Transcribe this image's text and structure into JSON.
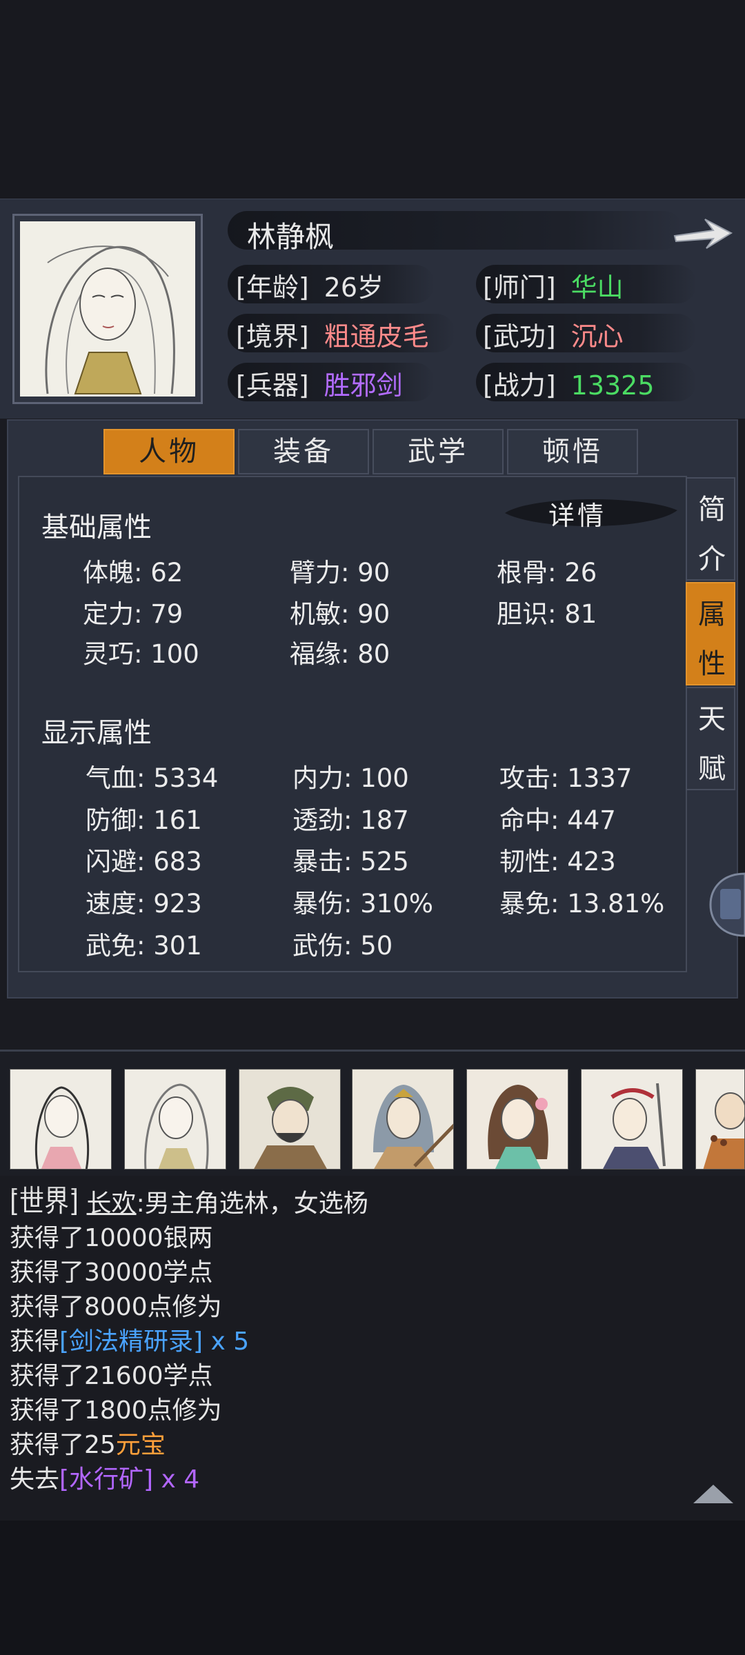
{
  "character": {
    "name": "林静枫",
    "age_label": "[年龄]",
    "age_value": "26岁",
    "sect_label": "[师门]",
    "sect_value": "华山",
    "realm_label": "[境界]",
    "realm_value": "粗通皮毛",
    "martial_label": "[武功]",
    "martial_value": "沉心",
    "weapon_label": "[兵器]",
    "weapon_value": "胜邪剑",
    "power_label": "[战力]",
    "power_value": "13325"
  },
  "tabs": [
    "人物",
    "装备",
    "武学",
    "顿悟"
  ],
  "side_tabs": [
    {
      "c1": "简",
      "c2": "介"
    },
    {
      "c1": "属",
      "c2": "性"
    },
    {
      "c1": "天",
      "c2": "赋"
    }
  ],
  "details_label": "详情",
  "basic": {
    "title": "基础属性",
    "items": [
      "体魄: 62",
      "臂力: 90",
      "根骨: 26",
      "定力: 79",
      "机敏: 90",
      "胆识: 81",
      "灵巧: 100",
      "福缘: 80"
    ]
  },
  "display": {
    "title": "显示属性",
    "items": [
      "气血: 5334",
      "内力: 100",
      "攻击: 1337",
      "防御: 161",
      "透劲: 187",
      "命中: 447",
      "闪避: 683",
      "暴击: 525",
      "韧性: 423",
      "速度: 923",
      "暴伤: 310%",
      "暴免: 13.81%",
      "武免: 301",
      "武伤: 50"
    ]
  },
  "log": {
    "l1_prefix": "[世界]",
    "l1_user": "长欢",
    "l1_text": ":男主角选林，女选杨",
    "l2": "获得了10000银两",
    "l3": "获得了30000学点",
    "l4": "获得了8000点修为",
    "l5_pre": "获得",
    "l5_item": "[剑法精研录] x 5",
    "l6": "获得了21600学点",
    "l7": "获得了1800点修为",
    "l8_pre": "获得了25",
    "l8_item": "元宝",
    "l9_pre": "失去",
    "l9_item": "[水行矿] x 4"
  },
  "colors": {
    "accent": "#d3801a",
    "green": "#4bdc63",
    "pink": "#ff8a8a",
    "purple": "#b36cff",
    "blue": "#4aa3ff",
    "orange": "#ff9f3a"
  }
}
